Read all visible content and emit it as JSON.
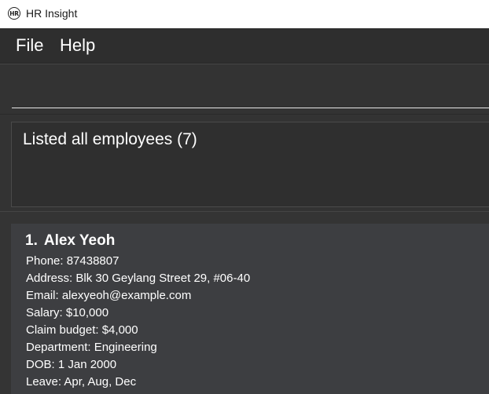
{
  "window": {
    "title": "HR Insight",
    "icon_text": "HR"
  },
  "menu": {
    "items": [
      "File",
      "Help"
    ]
  },
  "command_box": {
    "value": "",
    "placeholder": ""
  },
  "result_display": {
    "text": "Listed all employees (7)"
  },
  "employee_list": {
    "employees": [
      {
        "index": "1.",
        "name": "Alex Yeoh",
        "phone": "Phone: 87438807",
        "address": "Address: Blk 30 Geylang Street 29, #06-40",
        "email": "Email: alexyeoh@example.com",
        "salary": "Salary: $10,000",
        "claim_budget": "Claim budget: $4,000",
        "department": "Department: Engineering",
        "dob": "DOB: 1 Jan 2000",
        "leave": "Leave: Apr, Aug, Dec"
      }
    ]
  },
  "colors": {
    "titlebar_bg": "#ffffff",
    "menubar_bg": "#2e2e2e",
    "panel_bg": "#333333",
    "card_bg": "#3d3e41",
    "text": "#ffffff"
  }
}
